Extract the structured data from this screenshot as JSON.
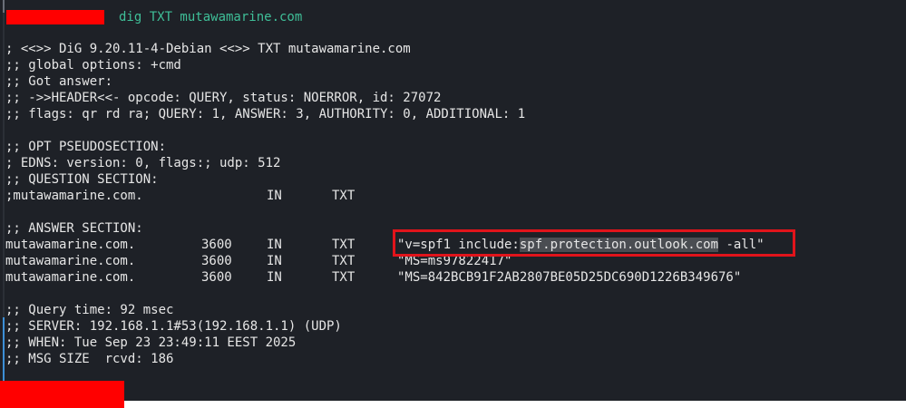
{
  "command": "dig TXT mutawamarine.com",
  "header_lines": [
    "; <<>> DiG 9.20.11-4-Debian <<>> TXT mutawamarine.com",
    ";; global options: +cmd",
    ";; Got answer:",
    ";; ->>HEADER<<- opcode: QUERY, status: NOERROR, id: 27072",
    ";; flags: qr rd ra; QUERY: 1, ANSWER: 3, AUTHORITY: 0, ADDITIONAL: 1"
  ],
  "opt_section": [
    ";; OPT PSEUDOSECTION:",
    "; EDNS: version: 0, flags:; udp: 512",
    ";; QUESTION SECTION:"
  ],
  "question": {
    "name": ";mutawamarine.com.",
    "class": "IN",
    "type": "TXT"
  },
  "answer_heading": ";; ANSWER SECTION:",
  "answers": [
    {
      "name": "mutawamarine.com.",
      "ttl": "3600",
      "class": "IN",
      "type": "TXT",
      "value_prefix": "\"v=spf1 include:",
      "value_highlight": "spf.protection.outlook.com",
      "value_suffix": " -all\""
    },
    {
      "name": "mutawamarine.com.",
      "ttl": "3600",
      "class": "IN",
      "type": "TXT",
      "value": "\"MS=ms97822417\""
    },
    {
      "name": "mutawamarine.com.",
      "ttl": "3600",
      "class": "IN",
      "type": "TXT",
      "value": "\"MS=842BCB91F2AB2807BE05D25DC690D1226B349676\""
    }
  ],
  "footer_lines": [
    ";; Query time: 92 msec",
    ";; SERVER: 192.168.1.1#53(192.168.1.1) (UDP)",
    ";; WHEN: Tue Sep 23 23:49:11 EEST 2025",
    ";; MSG SIZE  rcvd: 186"
  ],
  "colors": {
    "background": "#1e2127",
    "text": "#e6e6e6",
    "prompt_command": "#3fbf98",
    "redaction": "#ff0000",
    "highlight_box": "#e1141b"
  }
}
